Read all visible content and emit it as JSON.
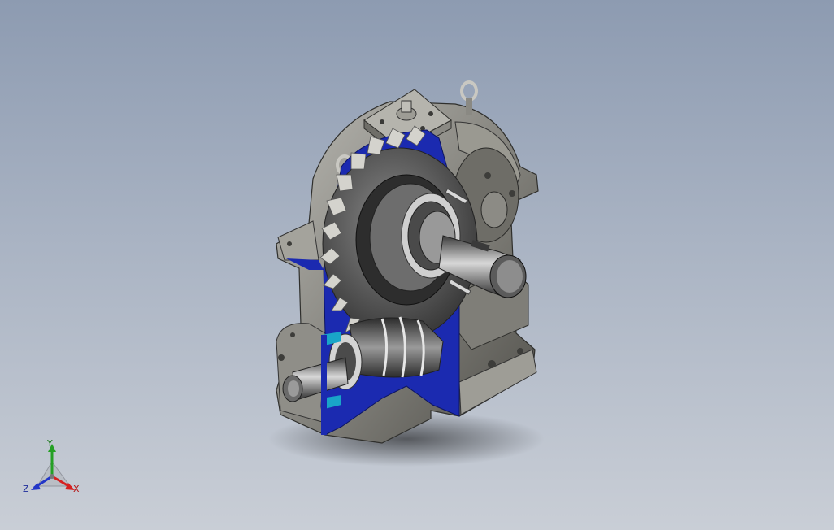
{
  "viewport": {
    "background_top": "#8d9bb1",
    "background_bottom": "#c9ced6"
  },
  "model": {
    "part_icon": "worm-gear-reducer-section-view",
    "casing_color": "#8e8d86",
    "section_color": "#1b2ab0",
    "seal_color": "#19a5c8"
  },
  "triad": {
    "x_label": "X",
    "y_label": "Y",
    "z_label": "Z",
    "x_color": "#d62020",
    "y_color": "#25a025",
    "z_color": "#2236c8"
  }
}
